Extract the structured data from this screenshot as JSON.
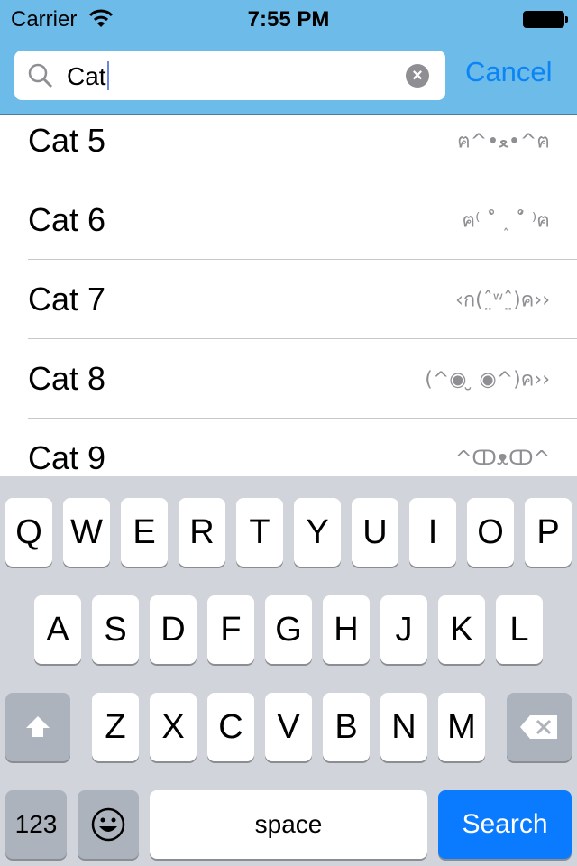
{
  "status_bar": {
    "carrier": "Carrier",
    "time": "7:55 PM",
    "battery": "full"
  },
  "search": {
    "query": "Cat",
    "cancel_label": "Cancel",
    "icons": [
      "search-icon",
      "clear-icon"
    ]
  },
  "colors": {
    "header": "#6dbbe9",
    "accent": "#0b84f5",
    "search_key": "#0a7bff"
  },
  "results": [
    {
      "title": "Cat 5",
      "kaomoji": "ฅ^•ﻌ•^ฅ"
    },
    {
      "title": "Cat 6",
      "kaomoji": "ฅ⁽ ˚̀ ˰ ˚́ ⁾ฅ"
    },
    {
      "title": "Cat 7",
      "kaomoji": "‹ก(ˆ̤ʷˆ̤)ค››"
    },
    {
      "title": "Cat 8",
      "kaomoji": "(^◉ ̮ ◉^)ค››"
    },
    {
      "title": "Cat 9",
      "kaomoji": "^ↀᴥↀ^"
    }
  ],
  "keyboard": {
    "row1": [
      "Q",
      "W",
      "E",
      "R",
      "T",
      "Y",
      "U",
      "I",
      "O",
      "P"
    ],
    "row2": [
      "A",
      "S",
      "D",
      "F",
      "G",
      "H",
      "J",
      "K",
      "L"
    ],
    "row3": [
      "Z",
      "X",
      "C",
      "V",
      "B",
      "N",
      "M"
    ],
    "numbers_label": "123",
    "space_label": "space",
    "search_label": "Search"
  }
}
